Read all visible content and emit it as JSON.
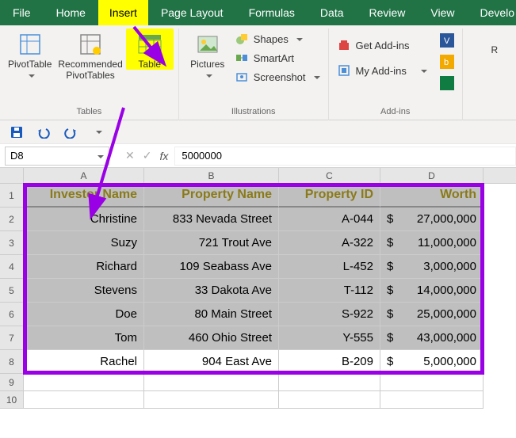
{
  "tabs": {
    "file": "File",
    "home": "Home",
    "insert": "Insert",
    "page_layout": "Page Layout",
    "formulas": "Formulas",
    "data": "Data",
    "review": "Review",
    "view": "View",
    "developer": "Develo"
  },
  "ribbon": {
    "tables": {
      "pivottable": "PivotTable",
      "recommended": "Recommended\nPivotTables",
      "table": "Table",
      "group": "Tables"
    },
    "illustrations": {
      "pictures": "Pictures",
      "shapes": "Shapes",
      "smartart": "SmartArt",
      "screenshot": "Screenshot",
      "group": "Illustrations"
    },
    "addins": {
      "get": "Get Add-ins",
      "my": "My Add-ins",
      "group": "Add-ins",
      "r": "R"
    }
  },
  "namebox": "D8",
  "formula": "5000000",
  "columns": {
    "A": "A",
    "B": "B",
    "C": "C",
    "D": "D"
  },
  "headers": {
    "investor": "Investor Name",
    "property": "Property Name",
    "pid": "Property ID",
    "worth": "Worth"
  },
  "rows": [
    {
      "n": "1"
    },
    {
      "n": "2",
      "investor": "Christine",
      "property": "833 Nevada Street",
      "pid": "A-044",
      "cur": "$",
      "worth": "27,000,000"
    },
    {
      "n": "3",
      "investor": "Suzy",
      "property": "721 Trout Ave",
      "pid": "A-322",
      "cur": "$",
      "worth": "11,000,000"
    },
    {
      "n": "4",
      "investor": "Richard",
      "property": "109 Seabass Ave",
      "pid": "L-452",
      "cur": "$",
      "worth": "3,000,000"
    },
    {
      "n": "5",
      "investor": "Stevens",
      "property": "33 Dakota Ave",
      "pid": "T-112",
      "cur": "$",
      "worth": "14,000,000"
    },
    {
      "n": "6",
      "investor": "Doe",
      "property": "80 Main Street",
      "pid": "S-922",
      "cur": "$",
      "worth": "25,000,000"
    },
    {
      "n": "7",
      "investor": "Tom",
      "property": "460 Ohio Street",
      "pid": "Y-555",
      "cur": "$",
      "worth": "43,000,000"
    },
    {
      "n": "8",
      "investor": "Rachel",
      "property": "904 East Ave",
      "pid": "B-209",
      "cur": "$",
      "worth": "5,000,000"
    }
  ],
  "empty_rows": [
    "9",
    "10"
  ]
}
